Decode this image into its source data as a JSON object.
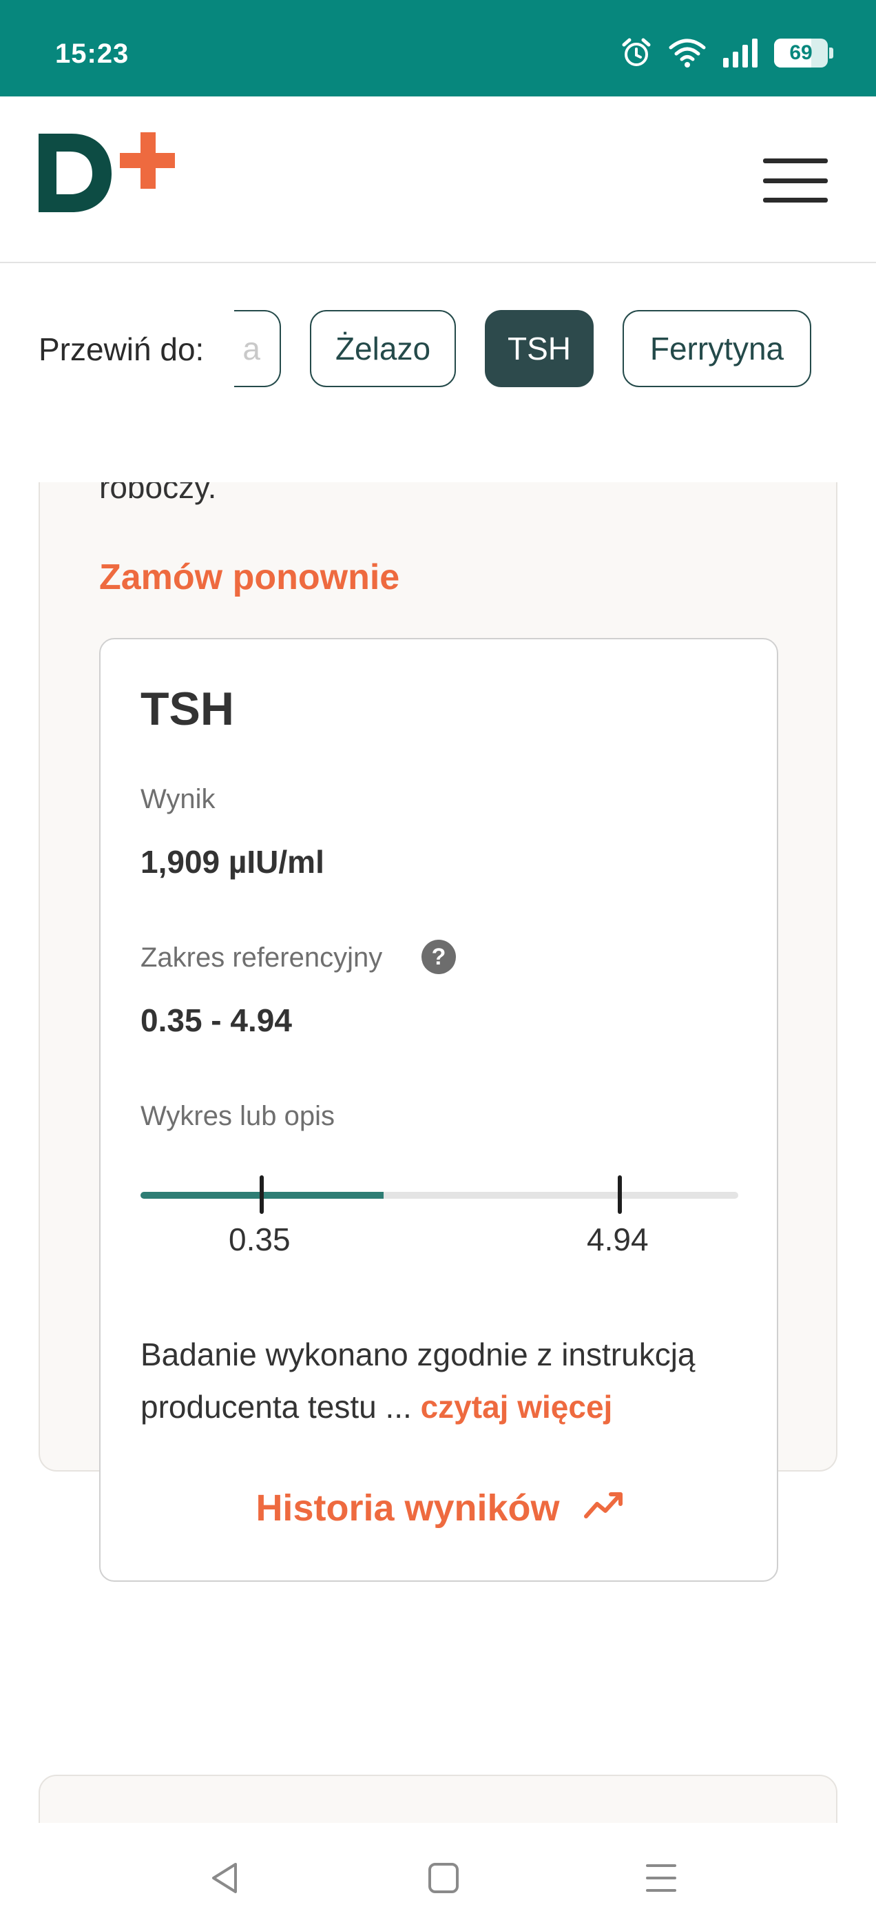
{
  "status_bar": {
    "time": "15:23",
    "battery": "69",
    "icons": [
      "alarm-icon",
      "wifi-icon",
      "signal-icon",
      "battery-icon"
    ]
  },
  "header": {
    "logo_letter": "D",
    "logo_symbol": "+",
    "menu_icon": "hamburger-menu-icon"
  },
  "scroll_nav": {
    "label": "Przewiń do:",
    "chips": [
      {
        "label": "a",
        "state": "partial"
      },
      {
        "label": "Żelazo",
        "state": "default"
      },
      {
        "label": "TSH",
        "state": "active"
      },
      {
        "label": "Ferrytyna",
        "state": "default"
      }
    ]
  },
  "card": {
    "prev_text": "roboczy.",
    "reorder_label": "Zamów ponownie",
    "result": {
      "title": "TSH",
      "result_label": "Wynik",
      "result_value": "1,909 µIU/ml",
      "reference_label": "Zakres referencyjny",
      "help_symbol": "?",
      "reference_value": "0.35 - 4.94",
      "chart_label": "Wykres lub opis",
      "range": {
        "low": 0.35,
        "high": 4.94,
        "low_label": "0.35",
        "high_label": "4.94",
        "result": 1.909
      },
      "description": "Badanie wykonano zgodnie z instrukcją producenta testu ...",
      "read_more": "czytaj więcej",
      "history_label": "Historia wyników",
      "history_icon": "trend-up-icon"
    }
  },
  "colors": {
    "status_bar": "#07877d",
    "brand_dark": "#0d4c44",
    "brand_accent": "#ee6a3f",
    "chip_active": "#2d4a4c",
    "range_fill": "#2e7d74"
  },
  "nav_bar": {
    "icons": [
      "back-icon",
      "home-icon",
      "recents-icon"
    ]
  }
}
